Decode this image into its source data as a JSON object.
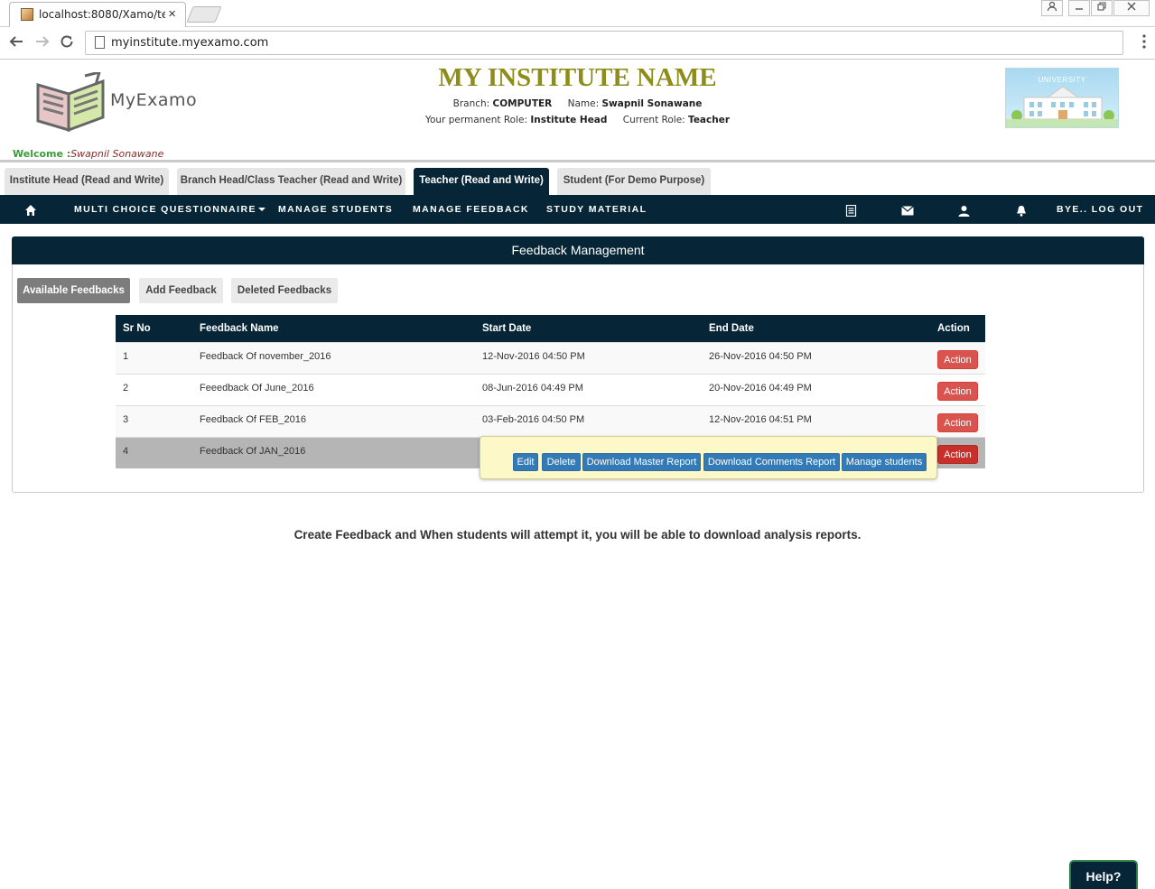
{
  "browser": {
    "tab_title": "localhost:8080/Xamo/tes",
    "close_glyph": "×",
    "url": "myinstitute.myexamo.com",
    "icons": [
      "back-arrow-icon",
      "forward-arrow-icon",
      "reload-icon",
      "page-icon",
      "menu-dots-icon",
      "user-icon",
      "minimize-icon",
      "restore-icon",
      "close-icon"
    ]
  },
  "header": {
    "logo_text": "MyExamo",
    "institute_name": "MY INSTITUTE NAME",
    "branch_label": "Branch:",
    "branch_value": "COMPUTER",
    "name_label": "Name:",
    "name_value": "Swapnil Sonawane",
    "permanent_role_label": "Your permanent Role:",
    "permanent_role_value": "Institute Head",
    "current_role_label": "Current Role:",
    "current_role_value": "Teacher",
    "university_label": "UNIVERSITY",
    "welcome_label": "Welcome :",
    "welcome_name": "Swapnil Sonawane"
  },
  "role_tabs": [
    {
      "label": "Institute Head (Read and Write)",
      "active": false
    },
    {
      "label": "Branch Head/Class Teacher (Read and Write)",
      "active": false
    },
    {
      "label": "Teacher (Read and Write)",
      "active": true
    },
    {
      "label": "Student (For Demo Purpose)",
      "active": false
    }
  ],
  "nav": {
    "home_icon": "home-icon",
    "items": [
      "MULTI CHOICE QUESTIONNAIRE",
      "MANAGE STUDENTS",
      "MANAGE FEEDBACK",
      "STUDY MATERIAL"
    ],
    "right_icons": [
      "list-icon",
      "envelope-icon",
      "user-icon",
      "bell-icon"
    ],
    "logout": "BYE.. LOG OUT"
  },
  "panel": {
    "title": "Feedback Management",
    "sub_tabs": [
      "Available Feedbacks",
      "Add Feedback",
      "Deleted Feedbacks"
    ],
    "active_sub_tab": "Available Feedbacks"
  },
  "table": {
    "columns": [
      "Sr No",
      "Feedback Name",
      "Start Date",
      "End Date",
      "Action"
    ],
    "rows": [
      {
        "sr": "1",
        "name": "Feedback Of november_2016",
        "start": "12-Nov-2016 04:50 PM",
        "end": "26-Nov-2016 04:50 PM",
        "action": "Action"
      },
      {
        "sr": "2",
        "name": "Feeedback Of June_2016",
        "start": "08-Jun-2016 04:49 PM",
        "end": "20-Nov-2016 04:49 PM",
        "action": "Action"
      },
      {
        "sr": "3",
        "name": "Feedback Of FEB_2016",
        "start": "03-Feb-2016 04:50 PM",
        "end": "12-Nov-2016 04:51 PM",
        "action": "Action"
      },
      {
        "sr": "4",
        "name": "Feedback Of JAN_2016",
        "start": "",
        "end": "",
        "action": "Action"
      }
    ]
  },
  "popup": {
    "buttons": [
      "Edit",
      "Delete",
      "Download Master Report",
      "Download Comments Report",
      "Manage students"
    ]
  },
  "message": "Create Feedback and When students will attempt it, you will be able to download analysis reports.",
  "help_label": "Help?",
  "colors": {
    "navy": "#062537",
    "institute_name": "#8e8d19",
    "action_red": "#d9534f",
    "popup_blue": "#337ab7",
    "popup_bg": "#fcf8c8"
  }
}
